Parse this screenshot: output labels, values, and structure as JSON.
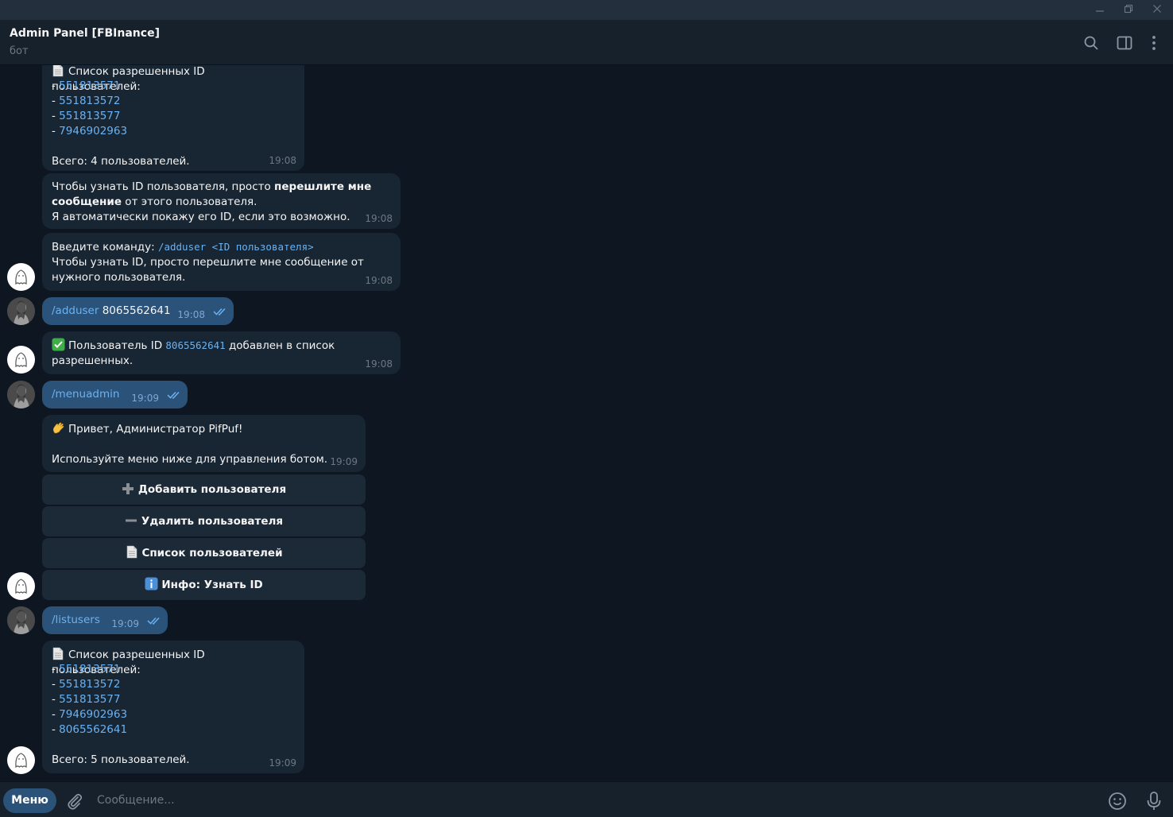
{
  "header": {
    "title": "Admin Panel [FBInance]",
    "subtitle": "бот"
  },
  "messages": {
    "m1": {
      "title": "Список разрешенных ID пользователей:",
      "ids": [
        "551813571",
        "551813572",
        "551813577",
        "7946902963"
      ],
      "dash": "- ",
      "total": "Всего: 4 пользователей.",
      "time": "19:08"
    },
    "m2": {
      "part1": "Чтобы узнать ID пользователя, просто ",
      "bold1": "перешлите мне",
      "bold2": "сообщение",
      "part2": " от этого пользователя.",
      "line3": "Я автоматически покажу его ID, если это возможно.",
      "time": "19:08"
    },
    "m3": {
      "prefix": "Введите команду: ",
      "code": "/adduser <ID пользователя>",
      "line2": "Чтобы узнать ID, просто перешлите мне сообщение от",
      "line3": "нужного пользователя.",
      "time": "19:08"
    },
    "m4": {
      "cmd": "/adduser",
      "arg": " 8065562641",
      "time": "19:08"
    },
    "m5": {
      "prefix": "Пользователь ID ",
      "id": "8065562641",
      "suffix": " добавлен в список",
      "line2": "разрешенных.",
      "time": "19:08"
    },
    "m6": {
      "cmd": "/menuadmin",
      "time": "19:09"
    },
    "m7": {
      "greeting": "Привет, Администратор PifPuf!",
      "line2": "Используйте меню ниже для управления ботом.",
      "time": "19:09"
    },
    "m8": {
      "cmd": "/listusers",
      "time": "19:09"
    },
    "m9": {
      "title": "Список разрешенных ID пользователей:",
      "ids": [
        "551813571",
        "551813572",
        "551813577",
        "7946902963",
        "8065562641"
      ],
      "dash": "- ",
      "total": "Всего: 5 пользователей.",
      "time": "19:09"
    }
  },
  "keyboard": {
    "add": "Добавить пользователя",
    "remove": "Удалить пользователя",
    "list": "Список пользователей",
    "info": "Инфо: Узнать ID"
  },
  "input": {
    "menu_label": "Меню",
    "placeholder": "Сообщение..."
  },
  "colors": {
    "background": "#0e1621",
    "incoming_bubble": "#182533",
    "outgoing_bubble": "#2b5278",
    "link": "#6ab2f2",
    "header": "#17212b"
  }
}
